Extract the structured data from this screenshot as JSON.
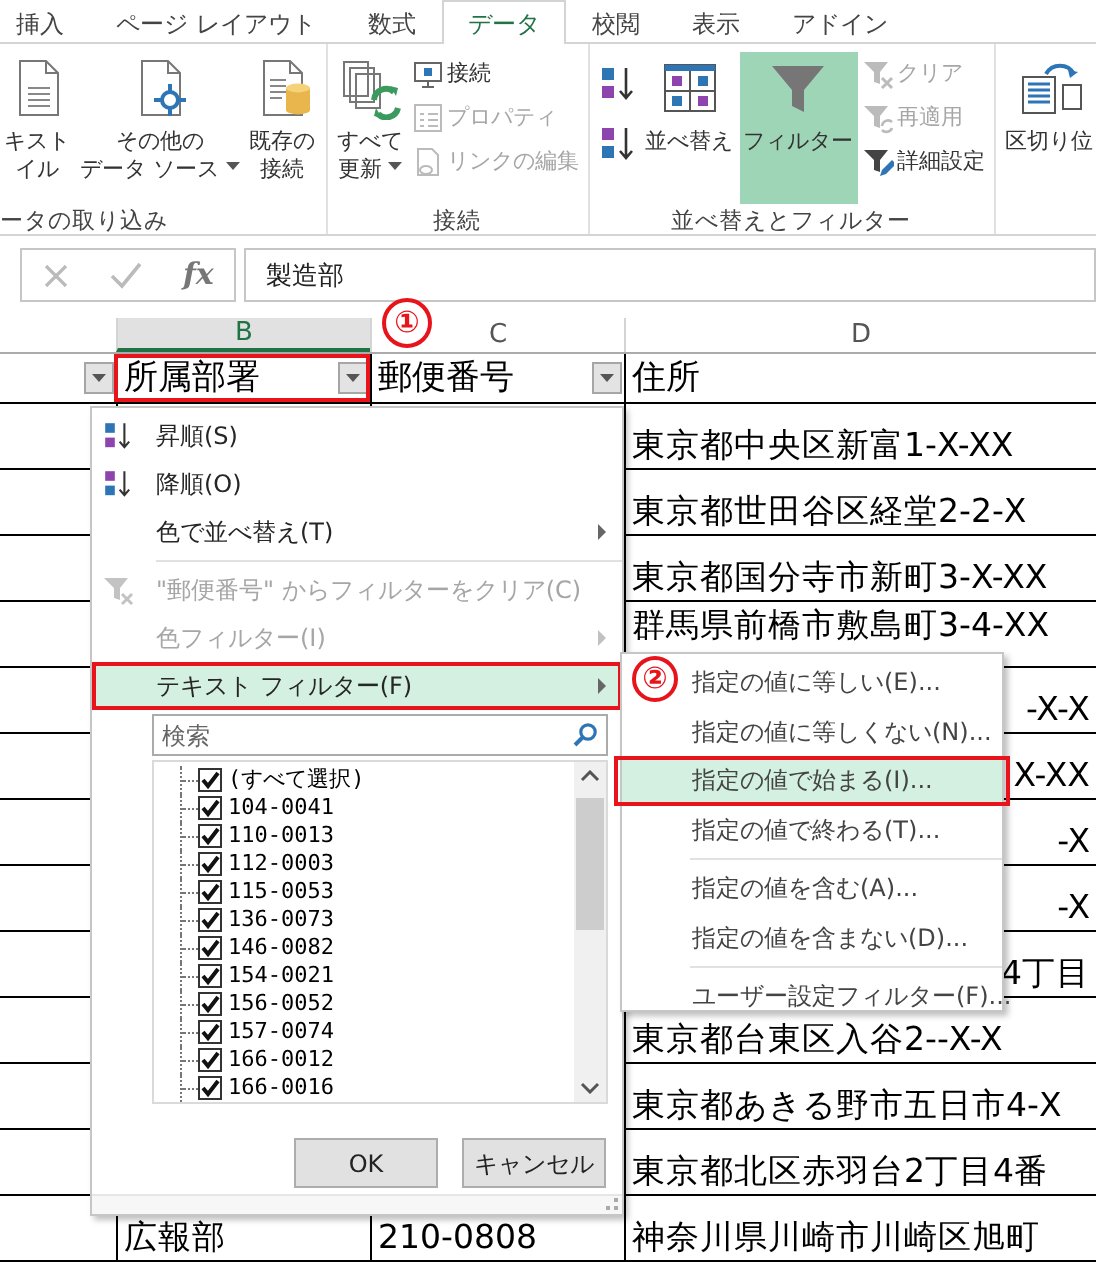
{
  "ribbon_tabs": [
    {
      "label": "挿入",
      "selected": false
    },
    {
      "label": "ページ レイアウト",
      "selected": false
    },
    {
      "label": "数式",
      "selected": false
    },
    {
      "label": "データ",
      "selected": true
    },
    {
      "label": "校閲",
      "selected": false
    },
    {
      "label": "表示",
      "selected": false
    },
    {
      "label": "アドイン",
      "selected": false
    }
  ],
  "ribbon_groups": [
    {
      "label": "ータの取り込み",
      "columns": [
        [
          {
            "kind": "large",
            "lines": [
              "キスト",
              "イル"
            ],
            "dropdown": false,
            "selected": false
          }
        ],
        [
          {
            "kind": "large",
            "lines": [
              "その他の",
              "データ ソース"
            ],
            "dropdown": true,
            "selected": false
          }
        ],
        [
          {
            "kind": "large",
            "lines": [
              "既存の",
              "接続"
            ],
            "dropdown": false,
            "selected": false
          }
        ]
      ]
    },
    {
      "label": "接続",
      "columns": [
        [
          {
            "kind": "large",
            "lines": [
              "すべて",
              "更新"
            ],
            "dropdown": true,
            "selected": false
          }
        ],
        [
          {
            "kind": "small",
            "label": "接続",
            "disabled": false
          },
          {
            "kind": "small",
            "label": "プロパティ",
            "disabled": true
          },
          {
            "kind": "small",
            "label": "リンクの編集",
            "disabled": true
          }
        ]
      ]
    },
    {
      "label": "並べ替えとフィルター",
      "columns": [
        [
          {
            "kind": "icon",
            "disabled": false
          },
          {
            "kind": "icon",
            "disabled": false
          }
        ],
        [
          {
            "kind": "large",
            "lines": [
              "並べ替え"
            ],
            "dropdown": false,
            "selected": false
          }
        ],
        [
          {
            "kind": "large",
            "lines": [
              "フィルター"
            ],
            "dropdown": false,
            "selected": true
          }
        ],
        [
          {
            "kind": "small",
            "label": "クリア",
            "disabled": true
          },
          {
            "kind": "small",
            "label": "再適用",
            "disabled": true
          },
          {
            "kind": "small",
            "label": "詳細設定",
            "disabled": false
          }
        ]
      ]
    },
    {
      "columns": [
        [
          {
            "kind": "large",
            "lines": [
              "区切り位"
            ],
            "dropdown": false,
            "selected": false
          }
        ]
      ]
    }
  ],
  "formula_bar": {
    "function_label": "fx",
    "value": "製造部"
  },
  "column_headers": [
    {
      "label": "B",
      "selected": true
    },
    {
      "label": "C",
      "selected": false
    },
    {
      "label": "D",
      "selected": false
    }
  ],
  "table": {
    "columns": [
      {
        "filter_button": true,
        "annotated": false
      },
      {
        "label": "所属部署",
        "filter_button": true,
        "annotated": true,
        "callout": "①"
      },
      {
        "label": "郵便番号",
        "filter_button": true,
        "annotated": false
      },
      {
        "label": "住所",
        "filter_button": false,
        "annotated": false
      }
    ],
    "rows": [
      {
        "kind": "full",
        "address": "東京都中央区新富1-X-XX"
      },
      {
        "kind": "full",
        "address": "東京都世田谷区経堂2-2-X"
      },
      {
        "kind": "full",
        "address": "東京都国分寺市新町3-X-XX"
      },
      {
        "kind": "full",
        "address": "群馬県前橋市敷島町3-4-XX"
      },
      {
        "kind": "tail",
        "address": "-X-X"
      },
      {
        "kind": "tail",
        "address": "X-XX"
      },
      {
        "kind": "tail",
        "address": "-X"
      },
      {
        "kind": "tail",
        "address": "-X"
      },
      {
        "kind": "tail",
        "address": "4丁目"
      },
      {
        "kind": "full",
        "address": "東京都台東区入谷2--X-X"
      },
      {
        "kind": "full",
        "address": "東京都あきる野市五日市4-X"
      },
      {
        "kind": "full",
        "address": "東京都北区赤羽台2丁目4番"
      },
      {
        "kind": "full",
        "department": "広報部",
        "postal_code": "210-0808",
        "address": "神奈川県川崎市川崎区旭町"
      }
    ]
  },
  "filter_menu": {
    "items": [
      {
        "kind": "command",
        "label": "昇順(S)",
        "disabled": false,
        "submenu": false,
        "highlighted": false,
        "annotated": false
      },
      {
        "kind": "command",
        "label": "降順(O)",
        "disabled": false,
        "submenu": false,
        "highlighted": false,
        "annotated": false
      },
      {
        "kind": "command",
        "label": "色で並べ替え(T)",
        "disabled": false,
        "submenu": true,
        "highlighted": false,
        "annotated": false
      },
      {
        "kind": "separator"
      },
      {
        "kind": "command",
        "label": "\"郵便番号\" からフィルターをクリア(C)",
        "disabled": true,
        "submenu": false,
        "highlighted": false,
        "annotated": false
      },
      {
        "kind": "command",
        "label": "色フィルター(I)",
        "disabled": true,
        "submenu": true,
        "highlighted": false,
        "annotated": false
      },
      {
        "kind": "command",
        "label": "テキスト フィルター(F)",
        "disabled": false,
        "submenu": true,
        "highlighted": true,
        "annotated": true
      }
    ],
    "search": {
      "placeholder": "検索"
    },
    "values": [
      {
        "label": "(すべて選択)",
        "checked": true
      },
      {
        "label": "104-0041",
        "checked": true
      },
      {
        "label": "110-0013",
        "checked": true
      },
      {
        "label": "112-0003",
        "checked": true
      },
      {
        "label": "115-0053",
        "checked": true
      },
      {
        "label": "136-0073",
        "checked": true
      },
      {
        "label": "146-0082",
        "checked": true
      },
      {
        "label": "154-0021",
        "checked": true
      },
      {
        "label": "156-0052",
        "checked": true
      },
      {
        "label": "157-0074",
        "checked": true
      },
      {
        "label": "166-0012",
        "checked": true
      },
      {
        "label": "166-0016",
        "checked": true
      }
    ],
    "buttons": [
      "OK",
      "キャンセル"
    ]
  },
  "text_filter_submenu": {
    "callout": "②",
    "items": [
      {
        "kind": "command",
        "label": "指定の値に等しい(E)...",
        "highlighted": false,
        "annotated": false
      },
      {
        "kind": "command",
        "label": "指定の値に等しくない(N)...",
        "highlighted": false,
        "annotated": false
      },
      {
        "kind": "command",
        "label": "指定の値で始まる(I)...",
        "highlighted": true,
        "annotated": true
      },
      {
        "kind": "command",
        "label": "指定の値で終わる(T)...",
        "highlighted": false,
        "annotated": false
      },
      {
        "kind": "separator"
      },
      {
        "kind": "command",
        "label": "指定の値を含む(A)...",
        "highlighted": false,
        "annotated": false
      },
      {
        "kind": "command",
        "label": "指定の値を含まない(D)...",
        "highlighted": false,
        "annotated": false
      },
      {
        "kind": "separator"
      },
      {
        "kind": "command",
        "label": "ユーザー設定フィルター(F)...",
        "highlighted": false,
        "annotated": false
      }
    ]
  }
}
